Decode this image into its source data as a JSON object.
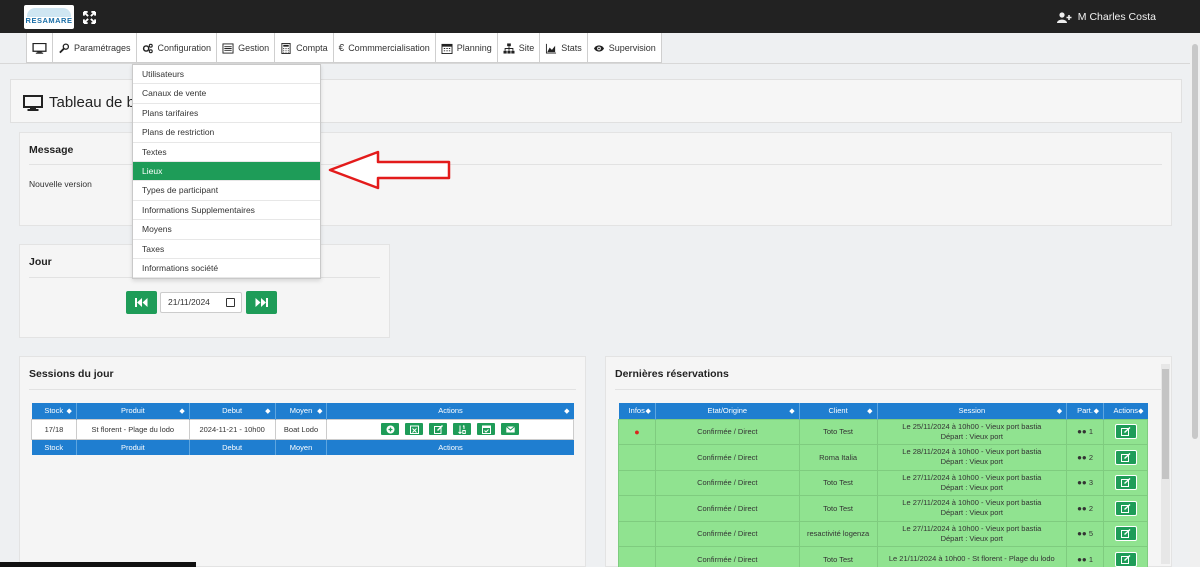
{
  "header": {
    "logo_text": "RESAMARE",
    "user_name": "M Charles Costa"
  },
  "nav": {
    "items": [
      "Paramétrages",
      "Configuration",
      "Gestion",
      "Compta",
      "Commmercialisation",
      "Planning",
      "Site",
      "Stats",
      "Supervision"
    ]
  },
  "dropdown": {
    "items": [
      "Utilisateurs",
      "Canaux de vente",
      "Plans tarifaires",
      "Plans de restriction",
      "Textes",
      "Lieux",
      "Types de participant",
      "Informations Supplementaires",
      "Moyens",
      "Taxes",
      "Informations société"
    ],
    "active_index": 5
  },
  "page": {
    "title": "Tableau de bord"
  },
  "message_panel": {
    "title": "Message",
    "text": "Nouvelle version"
  },
  "jour_panel": {
    "title": "Jour",
    "date_value": "21/11/2024"
  },
  "sessions_panel": {
    "title": "Sessions du jour",
    "columns": [
      "Stock",
      "Produit",
      "Debut",
      "Moyen",
      "Actions"
    ],
    "rows": [
      {
        "stock": "17/18",
        "produit": "St florent - Plage du lodo",
        "debut": "2024-11-21 - 10h00",
        "moyen": "Boat Lodo"
      }
    ]
  },
  "reservations_panel": {
    "title": "Dernières réservations",
    "columns": [
      "Infos",
      "Etat/Origine",
      "Client",
      "Session",
      "Part.",
      "Actions"
    ],
    "rows": [
      {
        "etat": "Confirmée / Direct",
        "client": "Toto Test",
        "session1": "Le 25/11/2024 à 10h00 - Vieux port bastia",
        "session2": "Départ : Vieux port",
        "part": "1",
        "info": true
      },
      {
        "etat": "Confirmée / Direct",
        "client": "Roma Italia",
        "session1": "Le 28/11/2024 à 10h00 - Vieux port bastia",
        "session2": "Départ : Vieux port",
        "part": "2",
        "info": false
      },
      {
        "etat": "Confirmée / Direct",
        "client": "Toto Test",
        "session1": "Le 27/11/2024 à 10h00 - Vieux port bastia",
        "session2": "Départ : Vieux port",
        "part": "3",
        "info": false
      },
      {
        "etat": "Confirmée / Direct",
        "client": "Toto Test",
        "session1": "Le 27/11/2024 à 10h00 - Vieux port bastia",
        "session2": "Départ : Vieux port",
        "part": "2",
        "info": false
      },
      {
        "etat": "Confirmée / Direct",
        "client": "resactivité logenza",
        "session1": "Le 27/11/2024 à 10h00 - Vieux port bastia",
        "session2": "Départ : Vieux port",
        "part": "5",
        "info": false
      },
      {
        "etat": "Confirmée / Direct",
        "client": "Toto Test",
        "session1": "Le 21/11/2024 à 10h00 - St florent - Plage du lodo",
        "session2": "",
        "part": "1",
        "info": false
      }
    ]
  },
  "colors": {
    "accent_green": "#1e9c58",
    "table_header_blue": "#1f7ed0",
    "reservation_row_green": "#90e390",
    "topbar": "#222222",
    "arrow_red": "#e31b1b"
  }
}
